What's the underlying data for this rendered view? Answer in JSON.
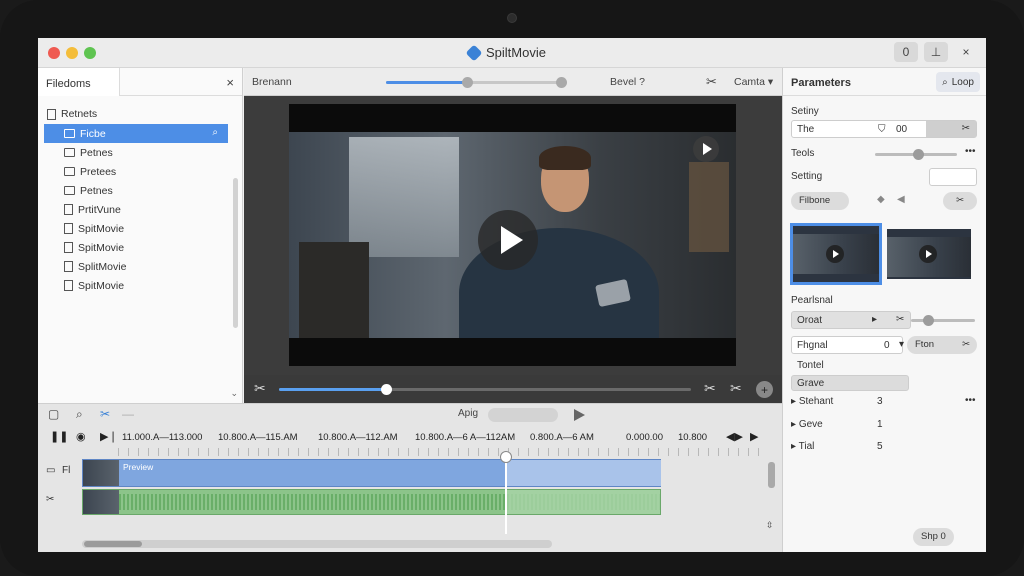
{
  "window": {
    "title": "SpiltMovie",
    "ctrl_a": "0",
    "ctrl_b": "⊥",
    "ctrl_close": "×"
  },
  "left_panel": {
    "tab_label": "Filedoms",
    "close": "×",
    "root_label": "Retnets",
    "items": [
      "Ficbe",
      "Petnes",
      "Pretees",
      "Petnes",
      "PrtitVune",
      "SpitMovie",
      "SpitMovie",
      "SplitMovie",
      "SpitMovie"
    ],
    "search_glyph": "⌕"
  },
  "viewer": {
    "toolbar_label": "Brenann",
    "toolbar_slider_progress": 0.45,
    "bevel_label": "Bevel ?",
    "camera_label": "Camta ▾",
    "scrub_progress": 0.26
  },
  "right_panel": {
    "title": "Parameters",
    "loop_button": "Loop",
    "setting_label": "Setiny",
    "setting_value": "The",
    "setting_extra": "00",
    "tools_label": "Teols",
    "tools_more": "•••",
    "setting2_label": "Setting",
    "chip_label": "Filbone",
    "section_label": "Pearlsnal",
    "input1": "Oroat",
    "input2_label": "Fhgnal",
    "input2_value": "0",
    "input2_pill": "Fton",
    "list_item_a": "Tontel",
    "list_item_b": "Grave",
    "rows": [
      {
        "label": "Stehant",
        "value": "3"
      },
      {
        "label": "Geve",
        "value": "1"
      },
      {
        "label": "Tial",
        "value": "5"
      }
    ],
    "rows_more": "•••",
    "bottom_button": "Shp 0"
  },
  "timeline": {
    "speed_label": "Apig",
    "timecodes": [
      "11.000.A—113.000",
      "10.800.A—115.AM",
      "10.800.A—112.AM",
      "10.800.A—6 A—112AM",
      "0.800.A—6 AM",
      "0.000.00",
      "10.800"
    ],
    "track1_label": "Fl",
    "clip_name": "Preview",
    "playhead_progress": 0.733
  }
}
